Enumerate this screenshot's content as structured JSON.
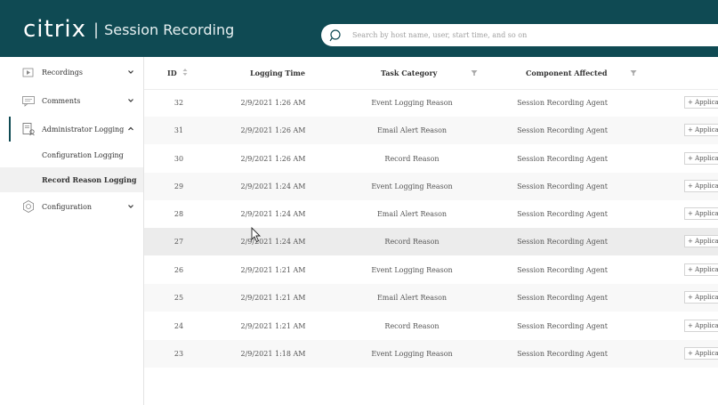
{
  "header": {
    "logo": "citrix",
    "separator": "|",
    "product": "Session Recording",
    "search_placeholder": "Search by host name, user, start time, and so on",
    "bg_color": "#0f4a53"
  },
  "sidebar": {
    "items": [
      {
        "label": "Recordings",
        "icon": "play-icon",
        "chevron": "chevron-down"
      },
      {
        "label": "Comments",
        "icon": "comment-icon",
        "chevron": "chevron-down"
      },
      {
        "label": "Administrator Logging",
        "icon": "admin-log-icon",
        "chevron": "chevron-up"
      },
      {
        "label": "Configuration",
        "icon": "gear-icon",
        "chevron": "chevron-down"
      }
    ],
    "subitems": [
      {
        "label": "Configuration Logging"
      },
      {
        "label": "Record Reason Logging"
      }
    ]
  },
  "table": {
    "columns": [
      "ID",
      "Logging Time",
      "Task Category",
      "Component Affected"
    ],
    "rows": [
      {
        "id": "32",
        "time": "2/9/2021 1:26 AM",
        "task": "Event Logging Reason",
        "component": "Session Recording Agent",
        "action": "+ Applicat"
      },
      {
        "id": "31",
        "time": "2/9/2021 1:26 AM",
        "task": "Email Alert Reason",
        "component": "Session Recording Agent",
        "action": "+ Applicat"
      },
      {
        "id": "30",
        "time": "2/9/2021 1:26 AM",
        "task": "Record Reason",
        "component": "Session Recording Agent",
        "action": "+ Applicat"
      },
      {
        "id": "29",
        "time": "2/9/2021 1:24 AM",
        "task": "Event Logging Reason",
        "component": "Session Recording Agent",
        "action": "+ Applicat"
      },
      {
        "id": "28",
        "time": "2/9/2021 1:24 AM",
        "task": "Email Alert Reason",
        "component": "Session Recording Agent",
        "action": "+ Applicat"
      },
      {
        "id": "27",
        "time": "2/9/2021 1:24 AM",
        "task": "Record Reason",
        "component": "Session Recording Agent",
        "action": "+ Applicat"
      },
      {
        "id": "26",
        "time": "2/9/2021 1:21 AM",
        "task": "Event Logging Reason",
        "component": "Session Recording Agent",
        "action": "+ Applicat"
      },
      {
        "id": "25",
        "time": "2/9/2021 1:21 AM",
        "task": "Email Alert Reason",
        "component": "Session Recording Agent",
        "action": "+ Applicat"
      },
      {
        "id": "24",
        "time": "2/9/2021 1:21 AM",
        "task": "Record Reason",
        "component": "Session Recording Agent",
        "action": "+ Applicat"
      },
      {
        "id": "23",
        "time": "2/9/2021 1:18 AM",
        "task": "Event Logging Reason",
        "component": "Session Recording Agent",
        "action": "+ Applicat"
      }
    ]
  }
}
